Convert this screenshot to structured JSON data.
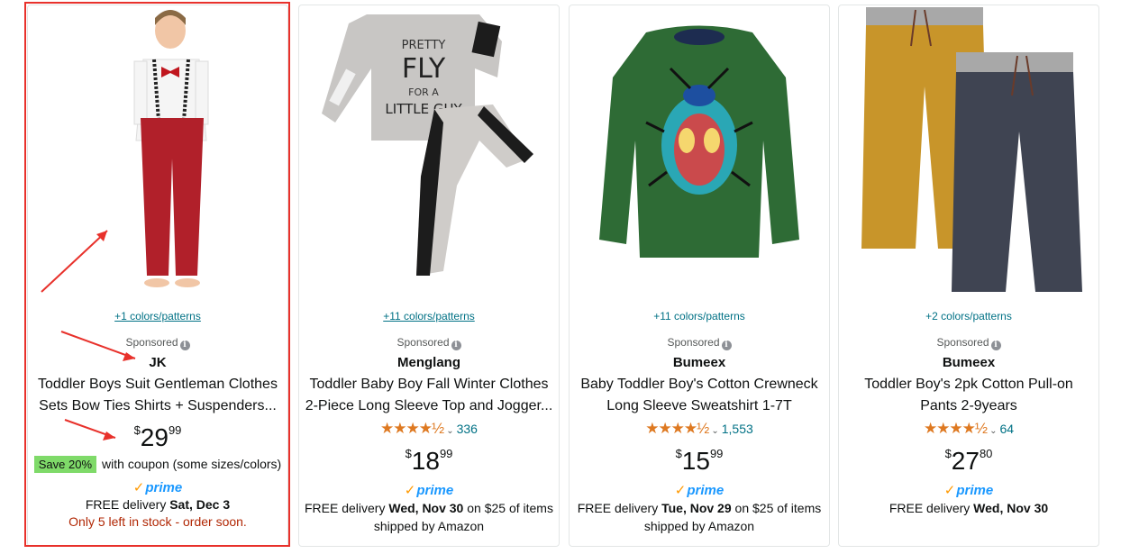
{
  "products": [
    {
      "colors": "+1 colors/patterns",
      "sponsored": "Sponsored",
      "brand": "JK",
      "title": "Toddler Boys Suit Gentleman Clothes Sets Bow Ties Shirts + Suspenders...",
      "price_sym": "$",
      "price_whole": "29",
      "price_frac": "99",
      "coupon_badge": "Save 20%",
      "coupon_text": "with coupon (some sizes/colors)",
      "prime": "prime",
      "delivery_prefix": "FREE delivery ",
      "delivery_date": "Sat, Dec 3",
      "stock": "Only 5 left in stock - order soon."
    },
    {
      "colors": "+11 colors/patterns",
      "sponsored": "Sponsored",
      "brand": "Menglang",
      "title": "Toddler Baby Boy Fall Winter Clothes 2-Piece Long Sleeve Top and Jogger...",
      "rating": 4.5,
      "stars": "★★★★½",
      "review_count": "336",
      "price_sym": "$",
      "price_whole": "18",
      "price_frac": "99",
      "prime": "prime",
      "delivery_prefix": "FREE delivery ",
      "delivery_date": "Wed, Nov 30",
      "delivery_suffix": " on $25 of items",
      "shipped_by": "shipped by Amazon",
      "image_text": "PRETTY FLY FOR A LITTLE GUY"
    },
    {
      "colors": "+11 colors/patterns",
      "sponsored": "Sponsored",
      "brand": "Bumeex",
      "title": "Baby Toddler Boy's Cotton Crewneck Long Sleeve Sweatshirt 1-7T",
      "rating": 4.5,
      "stars": "★★★★½",
      "review_count": "1,553",
      "price_sym": "$",
      "price_whole": "15",
      "price_frac": "99",
      "prime": "prime",
      "delivery_prefix": "FREE delivery ",
      "delivery_date": "Tue, Nov 29",
      "delivery_suffix": " on $25 of items",
      "shipped_by": "shipped by Amazon"
    },
    {
      "colors": "+2 colors/patterns",
      "sponsored": "Sponsored",
      "brand": "Bumeex",
      "title": "Toddler Boy's 2pk Cotton Pull-on Pants 2-9years",
      "rating": 4.5,
      "stars": "★★★★½",
      "review_count": "64",
      "price_sym": "$",
      "price_whole": "27",
      "price_frac": "80",
      "prime": "prime",
      "delivery_prefix": "FREE delivery ",
      "delivery_date": "Wed, Nov 30"
    }
  ],
  "icons": {
    "info": "i",
    "chevron": "⌄",
    "prime_check": "✓"
  },
  "colors": {
    "annotation": "#e8312b",
    "star": "#de7921",
    "link": "#007185",
    "stock": "#b12704",
    "coupon": "#7fda69",
    "prime": "#1a98ff"
  }
}
